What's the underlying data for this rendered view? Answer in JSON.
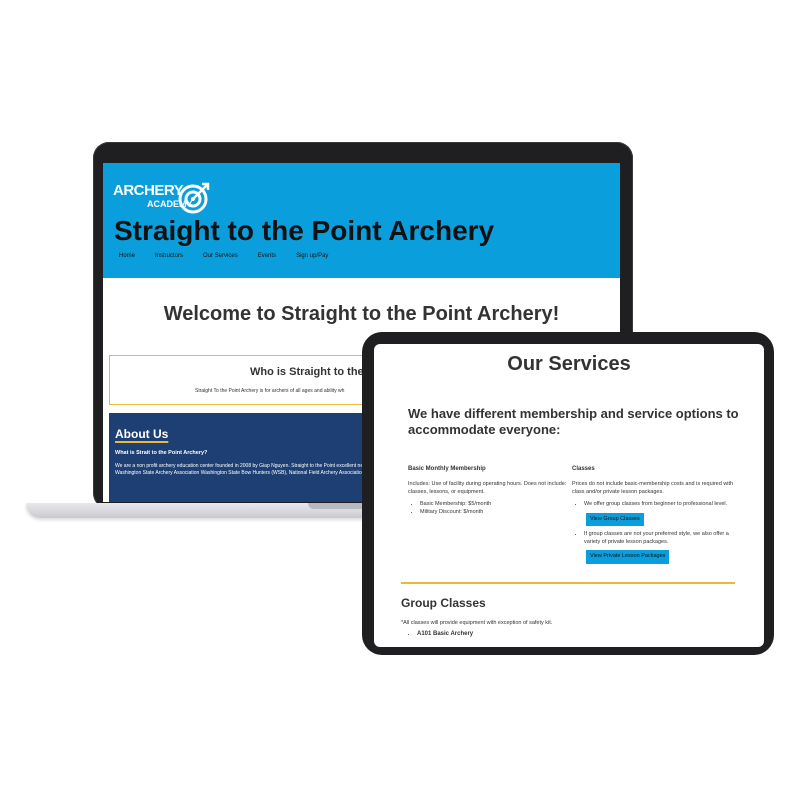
{
  "laptop": {
    "logo": {
      "word1": "ARCHERY",
      "word2": "ACADEMY"
    },
    "site_title": "Straight to the Point Archery",
    "nav": [
      "Home",
      "Instructors",
      "Our Services",
      "Events",
      "Sign up/Pay"
    ],
    "welcome": "Welcome to Straight to the Point Archery!",
    "who_title": "Who is Straight to the",
    "who_text": "Straight To the Point Archery is for archers of all ages and ability wh",
    "about_title": "About Us",
    "about_subtitle": "What is Strait to the Point Archery?",
    "about_text": "We are a non profit archery education center founded in 2008 by Giap Nguyen. Straight to the Point excellent network of contacts with the USA Archery (USAA), Washington State Archery Association Washington State Bow Hunters (WSB), National Field Archery Association (NFAA) and many more"
  },
  "tablet": {
    "title": "Our Services",
    "intro": "We have different membership and service options to accommodate everyone:",
    "membership": {
      "heading": "Basic Monthly Membership",
      "text": "Includes: Use of facility during operating hours. Does not include: classes, lessons, or equipment.",
      "items": [
        "Basic Membership: $5/month",
        "Military Discount: $/month"
      ]
    },
    "classes": {
      "heading": "Classes",
      "text": "Prices do not include basic-membership costs and is required with class and/or private lesson packages.",
      "item1": "We offer group classes from beginner to professional level.",
      "button1": "View Group Classes",
      "item2": "If group classes are not your preferred style, we also offer a variety of private lesson packages.",
      "button2": "View Private Lesson Packages"
    },
    "group_classes_title": "Group Classes",
    "group_classes_note": "*All classes will provide equipment with exception of safety kit.",
    "group_classes_items": [
      "A101 Basic Archery"
    ]
  },
  "colors": {
    "header_blue": "#0a9fdc",
    "navy": "#1e3f73",
    "gold": "#e8b93a",
    "device": "#1f1f21"
  }
}
